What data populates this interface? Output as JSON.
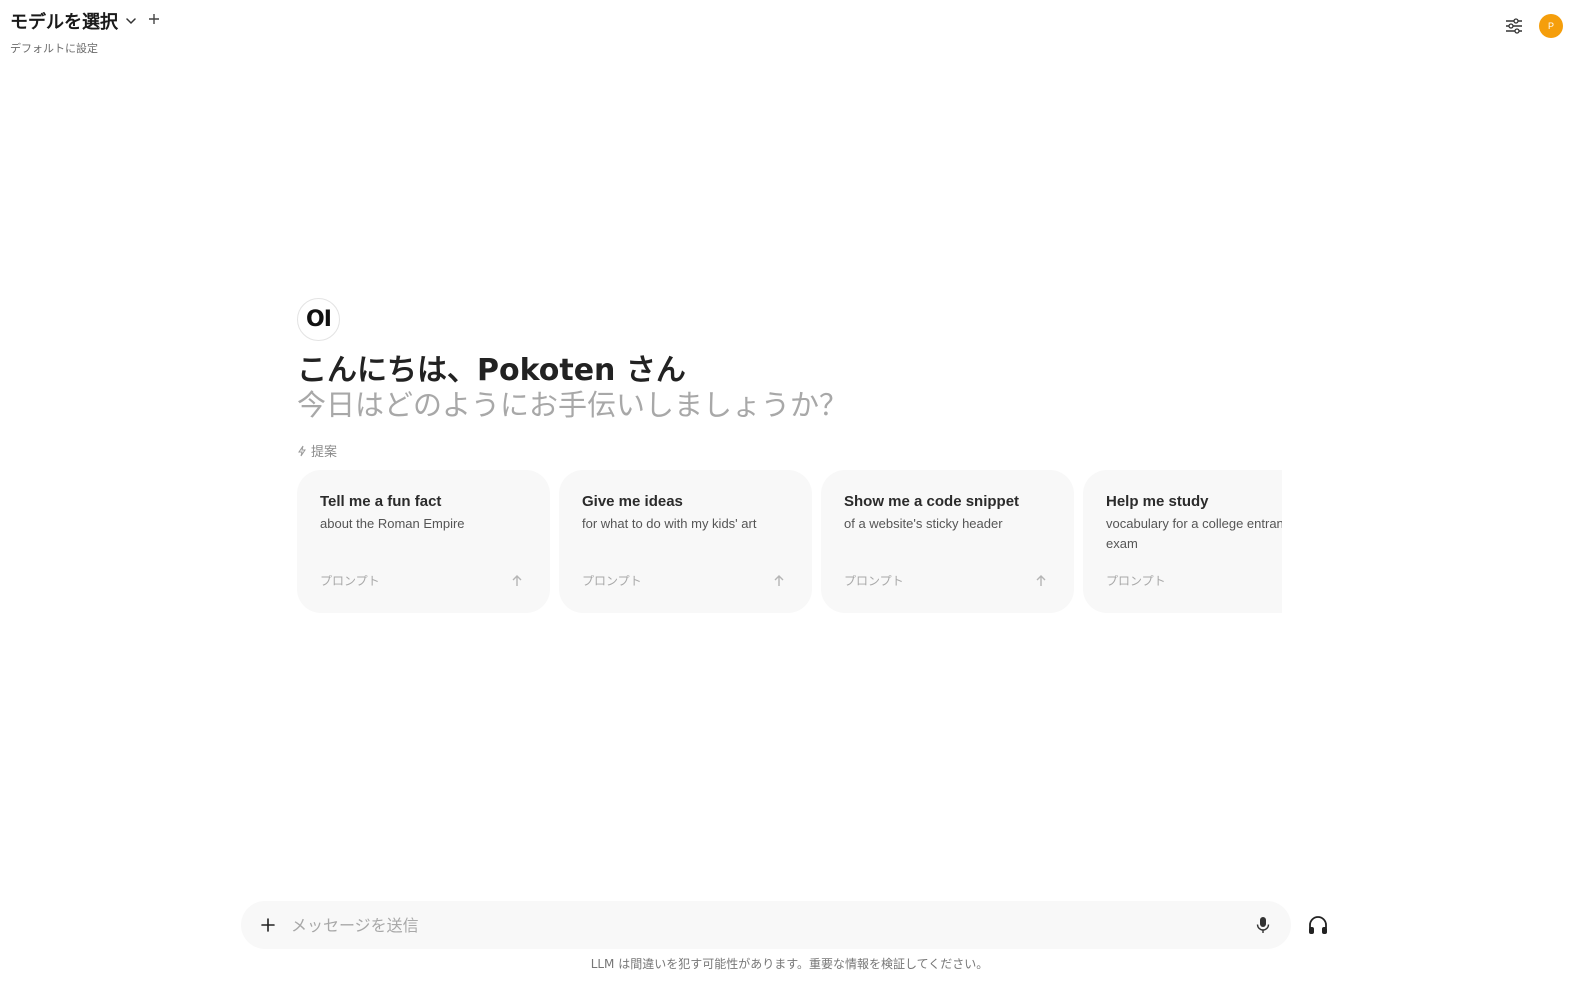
{
  "header": {
    "model_select_label": "モデルを選択",
    "set_default_label": "デフォルトに設定",
    "user_avatar_initial": "P"
  },
  "main": {
    "logo_text": "OI",
    "greeting": "こんにちは、Pokoten さん",
    "subtitle": "今日はどのようにお手伝いしましょうか？",
    "suggestions_label": "提案",
    "suggestions": [
      {
        "title": "Tell me a fun fact",
        "subtitle": "about the Roman Empire",
        "tag": "プロンプト"
      },
      {
        "title": "Give me ideas",
        "subtitle": "for what to do with my kids' art",
        "tag": "プロンプト"
      },
      {
        "title": "Show me a code snippet",
        "subtitle": "of a website's sticky header",
        "tag": "プロンプト"
      },
      {
        "title": "Help me study",
        "subtitle": "vocabulary for a college entrance exam",
        "tag": "プロンプト"
      }
    ]
  },
  "composer": {
    "placeholder": "メッセージを送信",
    "value": ""
  },
  "footer": {
    "disclaimer": "LLM は間違いを犯す可能性があります。重要な情報を検証してください。"
  },
  "colors": {
    "avatar_bg": "#f59e0b",
    "card_bg": "#f8f8f8",
    "subtitle_gray": "#a8a8a8"
  },
  "icons": [
    "chevron-down-icon",
    "plus-icon",
    "controls-sliders-icon",
    "lightning-icon",
    "arrow-up-icon",
    "microphone-icon",
    "headphones-icon"
  ]
}
